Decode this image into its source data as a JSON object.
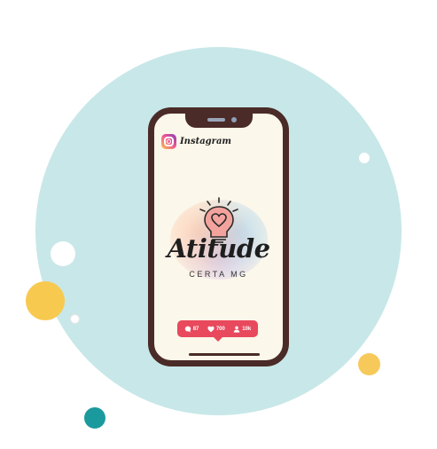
{
  "app": {
    "name": "Instagram"
  },
  "brand": {
    "title": "Atitude",
    "subtitle": "CERTA MG"
  },
  "stats": [
    {
      "icon": "comment-icon",
      "value": "87"
    },
    {
      "icon": "heart-icon",
      "value": "700"
    },
    {
      "icon": "user-icon",
      "value": "10k"
    }
  ],
  "colors": {
    "background_circle": "#c8e7e8",
    "phone_frame": "#4a2b27",
    "stats_badge": "#e8495d",
    "accent_yellow": "#f8c94f",
    "accent_teal": "#1b9a9e"
  }
}
